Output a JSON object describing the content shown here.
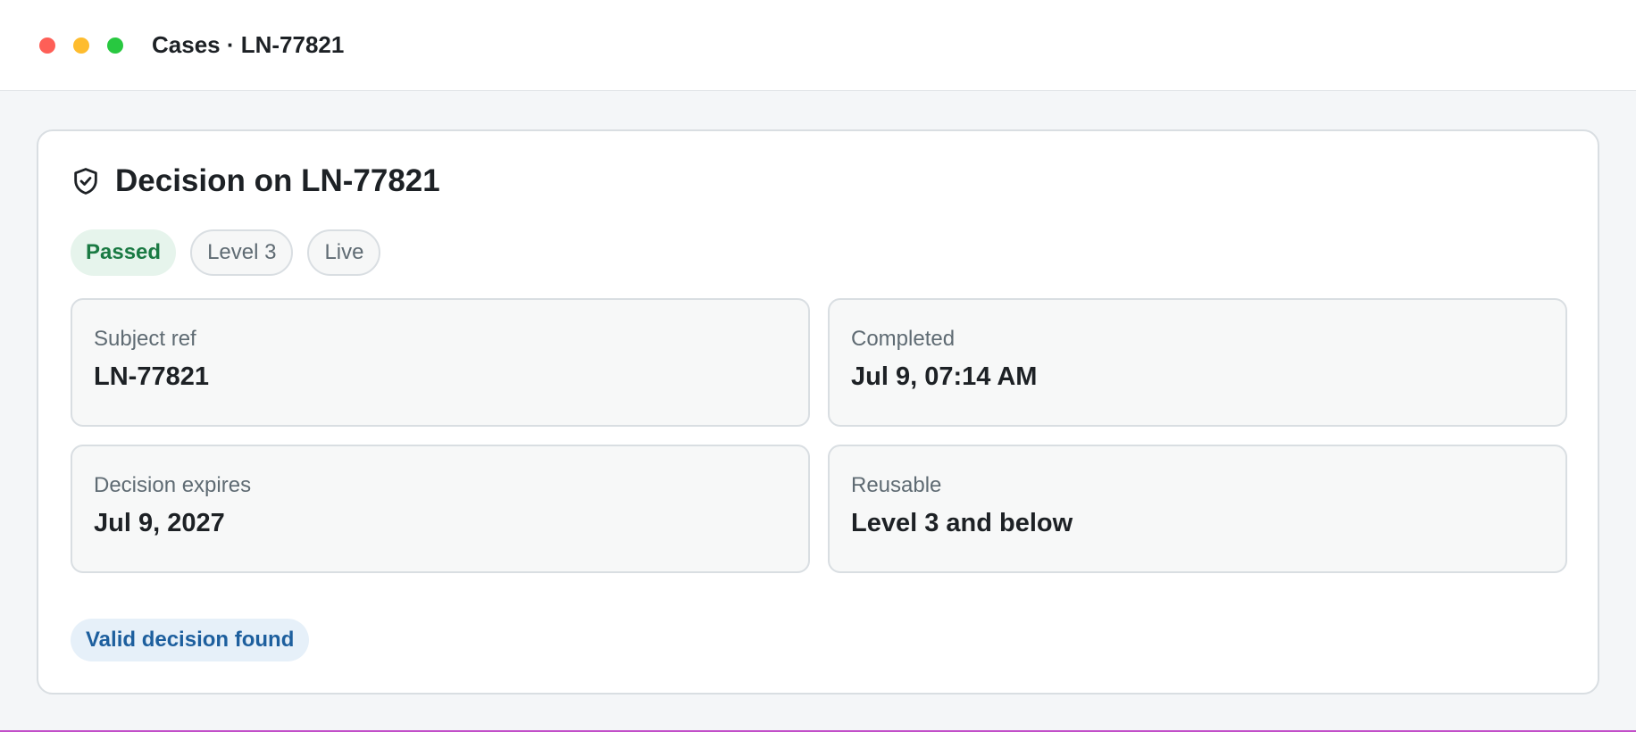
{
  "window": {
    "title": "Cases · LN-77821",
    "controls": {
      "close_color": "#fe5f57",
      "minimize_color": "#febc2e",
      "maximize_color": "#28c840"
    }
  },
  "card": {
    "icon": "shield-check-icon",
    "title": "Decision on LN-77821",
    "badges": {
      "status": "Passed",
      "level": "Level 3",
      "mode": "Live"
    },
    "fields": [
      {
        "label": "Subject ref",
        "value": "LN-77821"
      },
      {
        "label": "Completed",
        "value": "Jul 9, 07:14 AM"
      },
      {
        "label": "Decision expires",
        "value": "Jul 9, 2027"
      },
      {
        "label": "Reusable",
        "value": "Level 3 and below"
      }
    ],
    "result": "Valid decision found"
  },
  "colors": {
    "status_passed_bg": "#e6f4ec",
    "status_passed_text": "#1a7a43",
    "result_bg": "#e6f0f9",
    "result_text": "#1d5f9e"
  }
}
